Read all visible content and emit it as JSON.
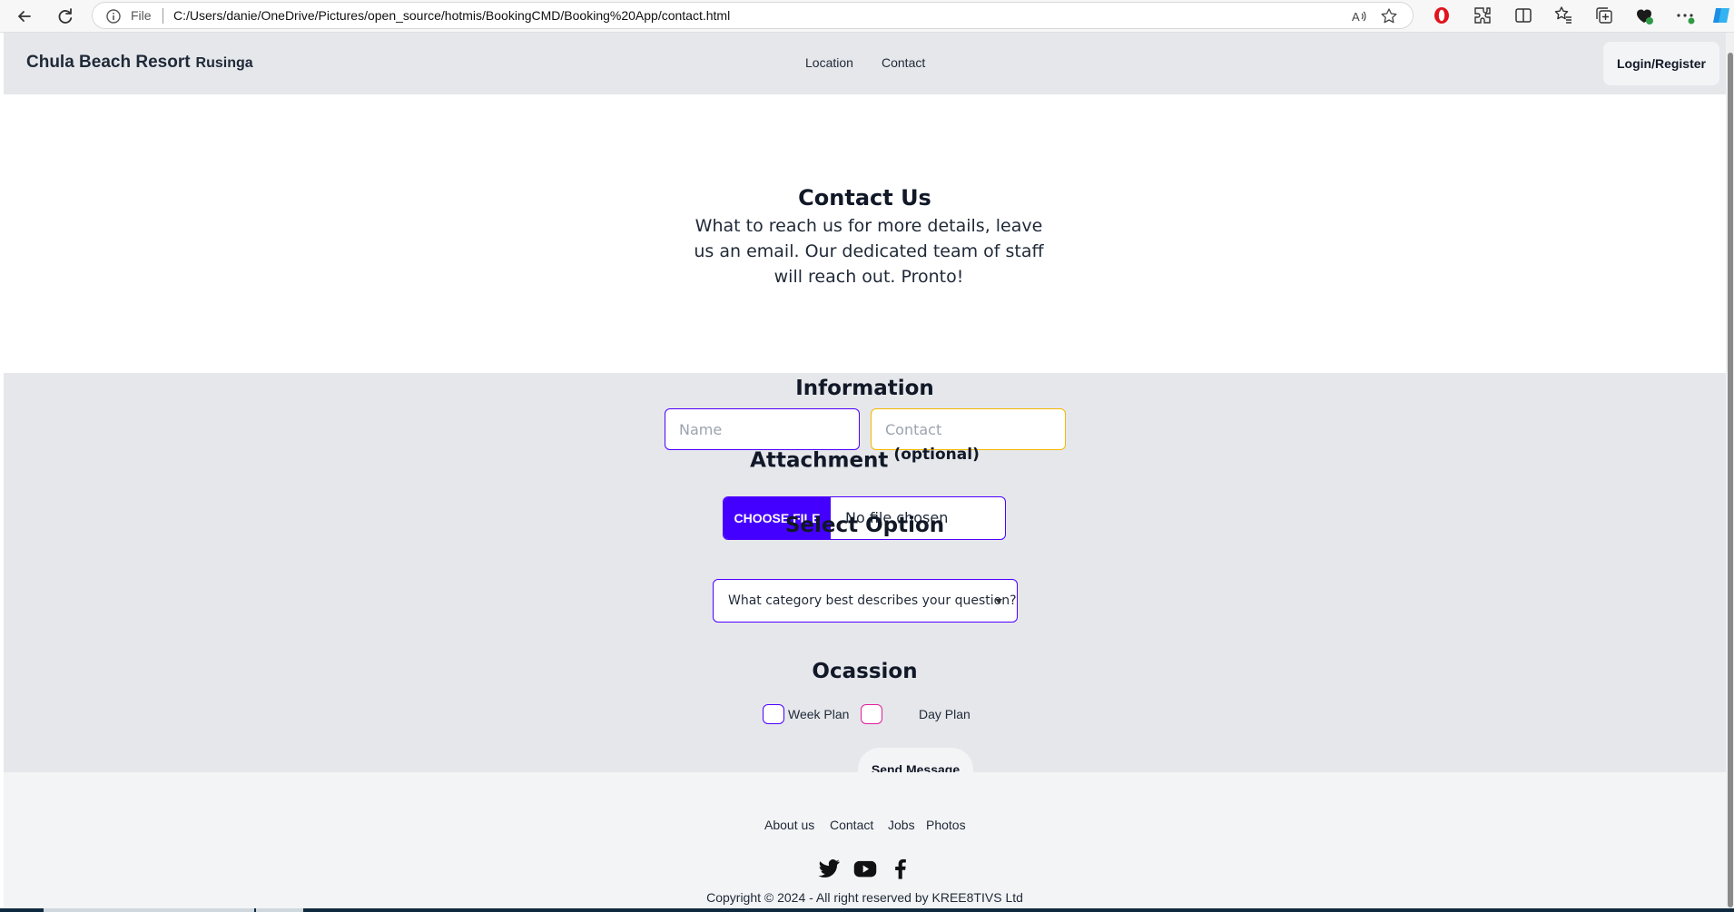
{
  "browser": {
    "scheme": "File",
    "url": "C:/Users/danie/OneDrive/Pictures/open_source/hotmis/BookingCMD/Booking%20App/contact.html"
  },
  "navbar": {
    "brand": "Chula Beach Resort",
    "brand_sub": "Rusinga",
    "links": [
      "Location",
      "Contact"
    ],
    "login_label": "Login/Register"
  },
  "hero": {
    "title": "Contact Us",
    "text": "What to reach us for more details, leave us an email. Our dedicated team of staff will reach out. Pronto!"
  },
  "form": {
    "information_heading": "Information",
    "name_placeholder": "Name",
    "contact_placeholder": "Contact",
    "attachment_heading": "Attachment",
    "attachment_optional": "(optional)",
    "choose_file_label": "CHOOSE FILE",
    "no_file_text": "No file chosen",
    "select_heading": "Select Option",
    "select_value": "What category best describes your question?",
    "occasion_heading": "Ocassion",
    "week_plan_label": "Week Plan",
    "day_plan_label": "Day Plan",
    "send_label": "Send Message"
  },
  "footer": {
    "links": [
      "About us",
      "Contact",
      "Jobs",
      "Photos"
    ],
    "social_icons": [
      "twitter-icon",
      "youtube-icon",
      "facebook-icon"
    ],
    "copyright": "Copyright © 2024 - All right reserved by KREE8TIVS Ltd"
  },
  "colors": {
    "navbar_bg": "#e5e7eb",
    "accent_purple": "#4400ff",
    "contact_border": "#f5b800",
    "day_plan_border": "#e11d9a"
  }
}
